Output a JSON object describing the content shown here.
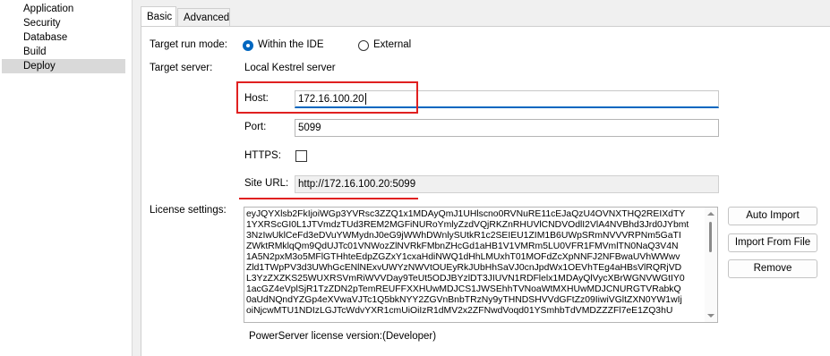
{
  "sidebar": {
    "items": [
      {
        "label": "Application"
      },
      {
        "label": "Security"
      },
      {
        "label": "Database"
      },
      {
        "label": "Build"
      },
      {
        "label": "Deploy",
        "selected": true
      }
    ]
  },
  "tabs": [
    {
      "label": "Basic",
      "active": true
    },
    {
      "label": "Advanced",
      "active": false
    }
  ],
  "form": {
    "target_run_mode_label": "Target run mode:",
    "run_mode_options": [
      {
        "label": "Within the IDE",
        "checked": true
      },
      {
        "label": "External",
        "checked": false
      }
    ],
    "target_server_label": "Target server:",
    "target_server_value": "Local Kestrel server",
    "host_label": "Host:",
    "host_value": "172.16.100.20",
    "port_label": "Port:",
    "port_value": "5099",
    "https_label": "HTTPS:",
    "https_checked": false,
    "site_url_label": "Site URL:",
    "site_url_value": "http://172.16.100.20:5099",
    "license_settings_label": "License settings:",
    "license_lines": [
      "eyJQYXlsb2FkIjoiWGp3YVRsc3ZZQ1x1MDAyQmJ1UHlscno0RVNuRE11cEJaQzU4OVNXTHQ2REIXdTY",
      "1YXRScGI0L1JTVmdzTUd3REM2MGFiNURoYmlyZzdVQjRKZnRHUVlCNDVOdlI2VlA4NVBhd3Jrd0JYbmt",
      "3NzIwUklCeFd3eDVuYWMydnJ0eG9jWWhDWnlySUtkR1c2SEIEU1ZIM1B6UWpSRmNVVVRPNm5GaTI",
      "ZWktRMklqQm9QdUJTc01VNWozZlNVRkFMbnZHcGd1aHB1V1VMRm5LU0VFR1FMVmlTN0NaQ3V4N",
      "1A5N2pxM3o5MFlGTHhteEdpZGZxY1cxaHdiNWQ1dHhLMUxhT01MOFdZcXpNNFJ2NFBwaUVhWWwv",
      "Zld1TWpPV3d3UWhGcENlNExvUWYzNWVtOUEyRkJUbHhSaVJ0cnJpdWx1OEVhTEg4aHBsVlRQRjVD",
      "L3YzZXZKS25WUXRSVmRiWVVDay9TeUt5ODJBYzlDT3JIUVN1RDFlelx1MDAyQlVycXBrWGNVWGtIY0",
      "1acGZ4eVplSjR1TzZDN2pTemREUFFXXHUwMDJCS1JWSEhhTVNoaWtMXHUwMDJCNURGTVRabkQ",
      "0aUdNQndYZGp4eXVwaVJTc1Q5bkNYY2ZGVnBnbTRzNy9yTHNDSHVVdGFtZz09IiwiVGltZXN0YW1wIj",
      "oiNjcwMTU1NDIzLGJTcWdvYXR1cmUiOiIzR1dMV2x2ZFNwdVoqd01YSmhbTdVMDZZZFl7eE1ZQ3hU"
    ],
    "license_version_label": "PowerServer license version:",
    "license_version_value": "(Developer)"
  },
  "buttons": {
    "import_auto": "Auto Import",
    "import_file": "Import From File",
    "remove": "Remove"
  },
  "colors": {
    "accent": "#0067c0",
    "highlight": "#e02020",
    "selected_bg": "#d9d9d9"
  }
}
